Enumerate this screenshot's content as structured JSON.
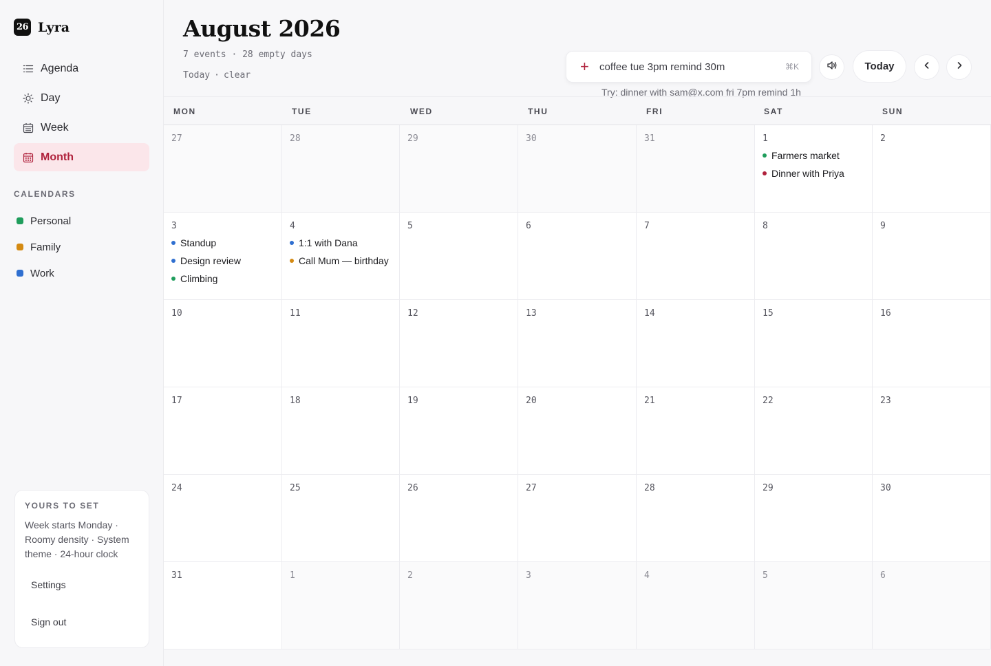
{
  "brand": {
    "badge": "26",
    "name": "Lyra"
  },
  "nav": [
    {
      "label": "Agenda",
      "icon": "list-icon",
      "active": false
    },
    {
      "label": "Day",
      "icon": "sun-icon",
      "active": false
    },
    {
      "label": "Week",
      "icon": "calendar-week-icon",
      "active": false
    },
    {
      "label": "Month",
      "icon": "calendar-month-icon",
      "active": true
    }
  ],
  "calendars_title": "CALENDARS",
  "calendars": [
    {
      "label": "Personal",
      "color": "#1f9d5c"
    },
    {
      "label": "Family",
      "color": "#d48a12"
    },
    {
      "label": "Work",
      "color": "#2f6fd0"
    }
  ],
  "prefs": {
    "title": "YOURS TO SET",
    "description": "Week starts Monday · Roomy density · System theme · 24-hour clock",
    "settings_label": "Settings",
    "signout_label": "Sign out"
  },
  "header": {
    "month_title": "August 2026",
    "meta": "7 events · 28 empty days",
    "today_link": "Today",
    "sep": "·",
    "clear_link": "clear",
    "quick_add_value": "coffee tue 3pm remind 30m",
    "quick_add_shortcut": "⌘K",
    "hint": "Try: dinner with sam@x.com fri 7pm remind 1h",
    "today_button": "Today"
  },
  "colors": {
    "accent": "#b0223c",
    "personal": "#1f9d5c",
    "family": "#d48a12",
    "work": "#2f6fd0",
    "dinner": "#b0223c"
  },
  "weekdays": [
    "MON",
    "TUE",
    "WED",
    "THU",
    "FRI",
    "SAT",
    "SUN"
  ],
  "weeks": [
    [
      {
        "date": "27",
        "outside": true,
        "events": []
      },
      {
        "date": "28",
        "outside": true,
        "events": []
      },
      {
        "date": "29",
        "outside": true,
        "events": []
      },
      {
        "date": "30",
        "outside": true,
        "events": []
      },
      {
        "date": "31",
        "outside": true,
        "events": []
      },
      {
        "date": "1",
        "outside": false,
        "events": [
          {
            "title": "Farmers market",
            "color": "#1f9d5c"
          },
          {
            "title": "Dinner with Priya",
            "color": "#b0223c"
          }
        ]
      },
      {
        "date": "2",
        "outside": false,
        "events": []
      }
    ],
    [
      {
        "date": "3",
        "outside": false,
        "events": [
          {
            "title": "Standup",
            "color": "#2f6fd0"
          },
          {
            "title": "Design review",
            "color": "#2f6fd0"
          },
          {
            "title": "Climbing",
            "color": "#1f9d5c"
          }
        ]
      },
      {
        "date": "4",
        "outside": false,
        "events": [
          {
            "title": "1:1 with Dana",
            "color": "#2f6fd0"
          },
          {
            "title": "Call Mum — birthday",
            "color": "#d48a12"
          }
        ]
      },
      {
        "date": "5",
        "outside": false,
        "events": []
      },
      {
        "date": "6",
        "outside": false,
        "events": []
      },
      {
        "date": "7",
        "outside": false,
        "events": []
      },
      {
        "date": "8",
        "outside": false,
        "events": []
      },
      {
        "date": "9",
        "outside": false,
        "events": []
      }
    ],
    [
      {
        "date": "10",
        "outside": false,
        "events": []
      },
      {
        "date": "11",
        "outside": false,
        "events": []
      },
      {
        "date": "12",
        "outside": false,
        "events": []
      },
      {
        "date": "13",
        "outside": false,
        "events": []
      },
      {
        "date": "14",
        "outside": false,
        "events": []
      },
      {
        "date": "15",
        "outside": false,
        "events": []
      },
      {
        "date": "16",
        "outside": false,
        "events": []
      }
    ],
    [
      {
        "date": "17",
        "outside": false,
        "events": []
      },
      {
        "date": "18",
        "outside": false,
        "events": []
      },
      {
        "date": "19",
        "outside": false,
        "events": []
      },
      {
        "date": "20",
        "outside": false,
        "events": []
      },
      {
        "date": "21",
        "outside": false,
        "events": []
      },
      {
        "date": "22",
        "outside": false,
        "events": []
      },
      {
        "date": "23",
        "outside": false,
        "events": []
      }
    ],
    [
      {
        "date": "24",
        "outside": false,
        "events": []
      },
      {
        "date": "25",
        "outside": false,
        "events": []
      },
      {
        "date": "26",
        "outside": false,
        "events": []
      },
      {
        "date": "27",
        "outside": false,
        "events": []
      },
      {
        "date": "28",
        "outside": false,
        "events": []
      },
      {
        "date": "29",
        "outside": false,
        "events": []
      },
      {
        "date": "30",
        "outside": false,
        "events": []
      }
    ],
    [
      {
        "date": "31",
        "outside": false,
        "events": []
      },
      {
        "date": "1",
        "outside": true,
        "events": []
      },
      {
        "date": "2",
        "outside": true,
        "events": []
      },
      {
        "date": "3",
        "outside": true,
        "events": []
      },
      {
        "date": "4",
        "outside": true,
        "events": []
      },
      {
        "date": "5",
        "outside": true,
        "events": []
      },
      {
        "date": "6",
        "outside": true,
        "events": []
      }
    ]
  ]
}
